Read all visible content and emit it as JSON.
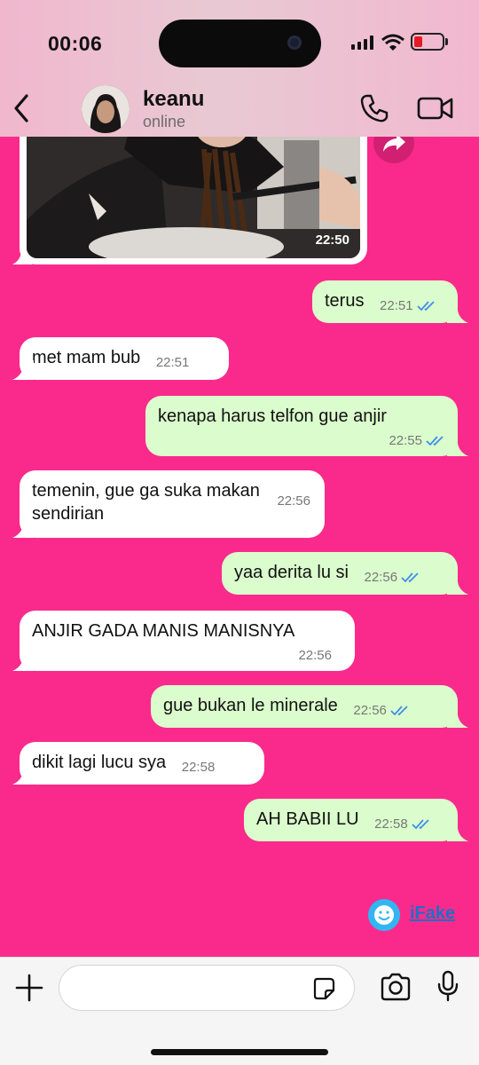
{
  "status_bar": {
    "time": "00:06",
    "battery_color": "#e51b24",
    "battery_level_fraction": 0.3
  },
  "header": {
    "contact_name": "keanu",
    "contact_status": "online"
  },
  "photo_message": {
    "time": "22:50"
  },
  "messages": [
    {
      "direction": "out",
      "text": "terus",
      "time": "22:51",
      "read": true
    },
    {
      "direction": "in",
      "text": "met mam bub",
      "time": "22:51"
    },
    {
      "direction": "out",
      "text": "kenapa harus telfon gue anjir",
      "time": "22:55",
      "read": true
    },
    {
      "direction": "in",
      "text": "temenin, gue ga suka makan sendirian",
      "time": "22:56"
    },
    {
      "direction": "out",
      "text": "yaa derita lu si",
      "time": "22:56",
      "read": true
    },
    {
      "direction": "in",
      "text": "ANJIR GADA MANIS MANISNYA",
      "time": "22:56"
    },
    {
      "direction": "out",
      "text": "gue bukan le minerale",
      "time": "22:56",
      "read": true
    },
    {
      "direction": "in",
      "text": "dikit lagi lucu sya",
      "time": "22:58"
    },
    {
      "direction": "out",
      "text": "AH BABII LU",
      "time": "22:58",
      "read": true
    }
  ],
  "watermark": {
    "label": "iFake"
  },
  "composer": {
    "placeholder": ""
  },
  "colors": {
    "chat_background": "#fa2a8c",
    "outgoing_bubble": "#dbfdcd",
    "incoming_bubble": "#ffffff",
    "read_ticks": "#3d8ee8"
  },
  "icons": {
    "back": "chevron-left-icon",
    "call": "phone-icon",
    "video": "video-camera-icon",
    "share": "forward-icon",
    "attach": "plus-icon",
    "sticker": "sticker-icon",
    "camera": "camera-icon",
    "mic": "microphone-icon"
  }
}
